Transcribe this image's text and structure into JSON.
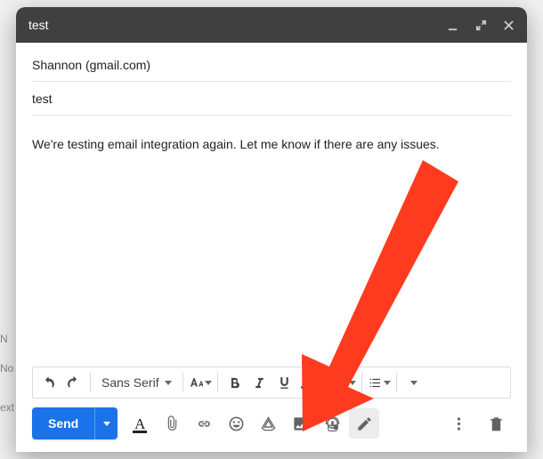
{
  "window": {
    "title": "test"
  },
  "fields": {
    "to": "Shannon (gmail.com)",
    "subject": "test"
  },
  "body": "We're testing email integration again. Let me know if there are any issues.",
  "format_toolbar": {
    "font": "Sans Serif"
  },
  "actions": {
    "send_label": "Send"
  },
  "colors": {
    "primary": "#1a73e8",
    "annotation": "#ff3b1f"
  },
  "bg_hints": {
    "a": "N",
    "b": "No",
    "c": "ext"
  }
}
